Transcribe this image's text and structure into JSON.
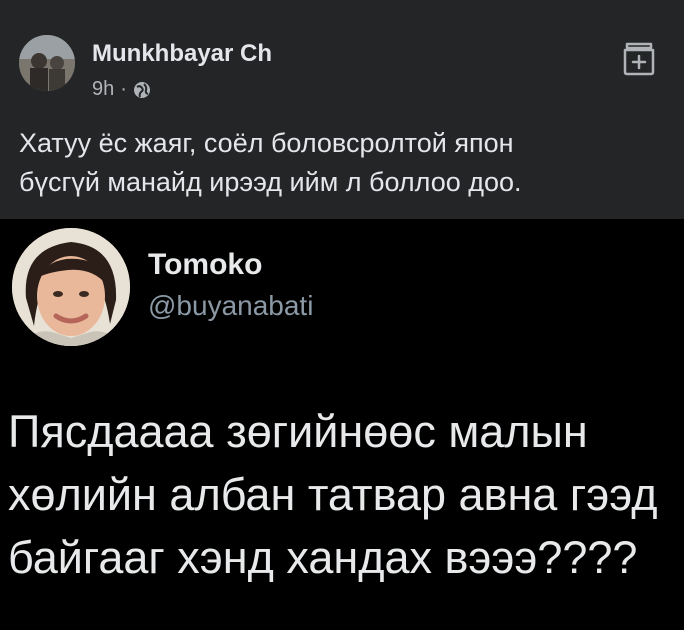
{
  "post": {
    "author": "Munkhbayar Ch",
    "time": "9h",
    "separator": "·",
    "icons": {
      "privacy": "globe-icon",
      "action": "save-post-icon"
    },
    "text_lines": [
      "Хатуу ёс жаяг, соёл боловсролтой япон",
      "бүсгүй манайд ирээд ийм л боллоо доо."
    ]
  },
  "tweet": {
    "name": "Tomoko",
    "handle": "@buyanabati",
    "text_lines": [
      "Пясдаааа зөгийнөөс малын",
      "хөлийн албан татвар авна гээд",
      "байгааг хэнд хандах вэээ????"
    ]
  },
  "colors": {
    "post_bg": "#242526",
    "tweet_bg": "#000000",
    "text": "#e4e6eb",
    "muted": "#b0b3b8"
  }
}
